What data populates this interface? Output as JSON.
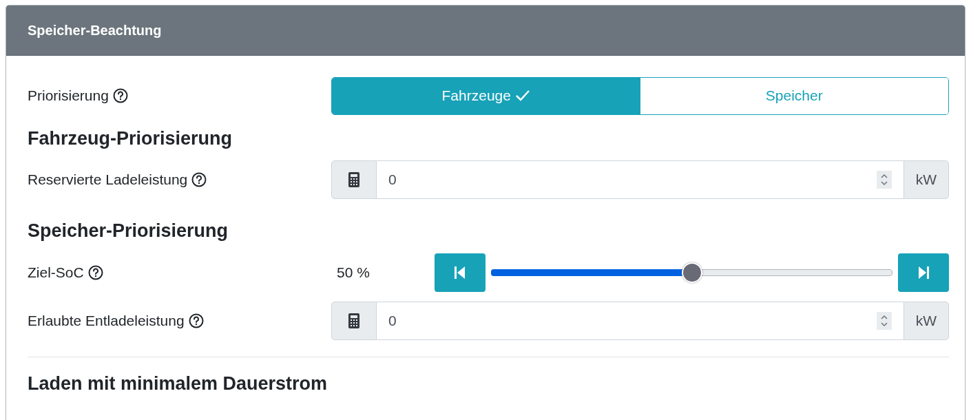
{
  "card": {
    "title": "Speicher-Beachtung"
  },
  "rows": [
    {
      "kind": "toggle",
      "label": "Priorisierung",
      "options": [
        {
          "label": "Fahrzeuge",
          "selected": true
        },
        {
          "label": "Speicher",
          "selected": false
        }
      ]
    },
    {
      "kind": "heading",
      "text": "Fahrzeug-Priorisierung"
    },
    {
      "kind": "number",
      "label": "Reservierte Ladeleistung",
      "value": "0",
      "unit": "kW"
    },
    {
      "kind": "heading",
      "text": "Speicher-Priorisierung"
    },
    {
      "kind": "slider",
      "label": "Ziel-SoC",
      "reading": "50 %",
      "level": 0.5
    },
    {
      "kind": "number",
      "label": "Erlaubte Entladeleistung",
      "value": "0",
      "unit": "kW"
    },
    {
      "kind": "divider"
    },
    {
      "kind": "heading",
      "text": "Laden mit minimalem Dauerstrom"
    }
  ]
}
